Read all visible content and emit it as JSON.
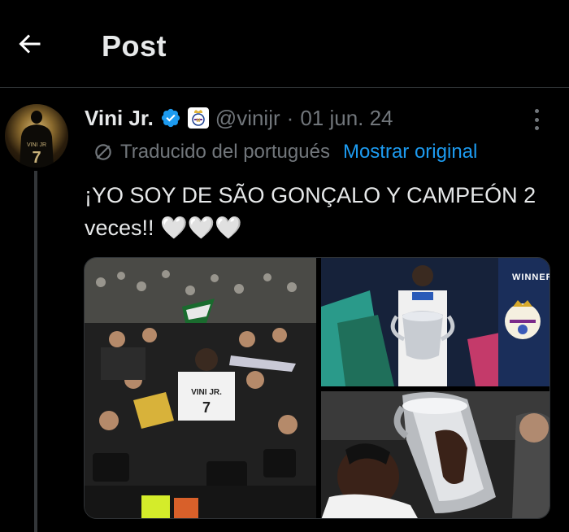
{
  "header": {
    "title": "Post",
    "back_icon": "arrow-left-icon"
  },
  "post": {
    "author_name": "Vini Jr.",
    "handle": "@vinijr",
    "separator": "·",
    "date": "01 jun. 24",
    "verified_icon": "verified-badge-icon",
    "affiliate_icon": "real-madrid-badge-icon",
    "translation_label": "Traducido del portugués",
    "show_original": "Mostrar original",
    "text": "¡YO SOY DE SÃO GONÇALO Y CAMPEÓN 2 veces!! 🤍🤍🤍",
    "media": {
      "banner_text": "WINNER"
    }
  },
  "colors": {
    "background": "#000000",
    "text": "#e7e9ea",
    "muted": "#71767b",
    "accent": "#1d9bf0",
    "border": "#2f3336"
  }
}
